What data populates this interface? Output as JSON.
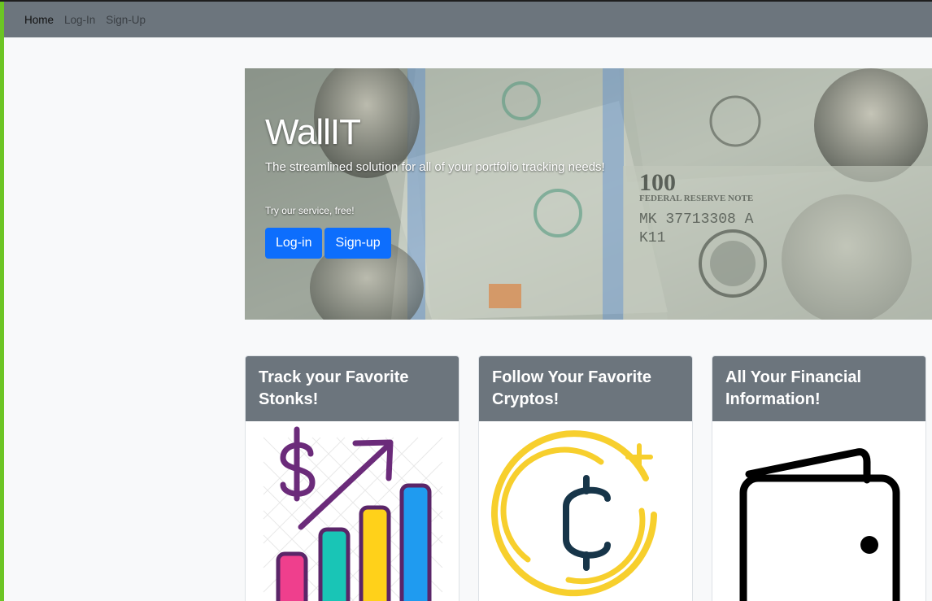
{
  "navbar": {
    "links": [
      "Home",
      "Log-In",
      "Sign-Up"
    ]
  },
  "hero": {
    "title": "WallIT",
    "subtitle": "The streamlined solution for all of your portfolio tracking needs!",
    "note": "Try our service, free!",
    "login_label": "Log-in",
    "signup_label": "Sign-up",
    "bill_text": [
      "100",
      "FEDERAL RESERVE NOTE",
      "MK 37713308 A",
      "K11"
    ]
  },
  "cards": [
    {
      "title": "Track your Favorite Stonks!",
      "icon": "stock-growth-chart-icon"
    },
    {
      "title": "Follow Your Favorite Cryptos!",
      "icon": "crypto-coin-icon"
    },
    {
      "title": "All Your Financial Information!",
      "icon": "wallet-icon"
    }
  ],
  "colors": {
    "navbar": "#6c757d",
    "primary_button": "#0d6efd",
    "page_background": "#f8f9fa",
    "accent_left": "#6cc524"
  }
}
